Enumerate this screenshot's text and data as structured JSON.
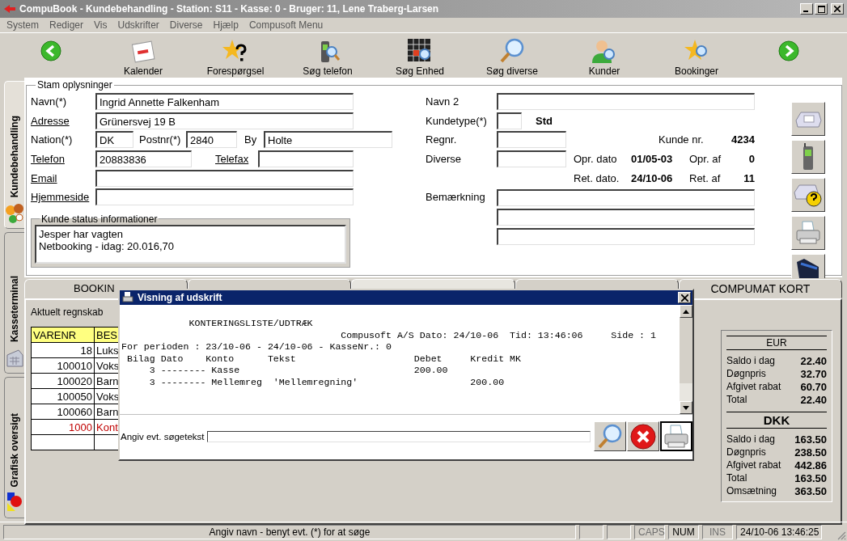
{
  "window": {
    "title": "CompuBook - Kundebehandling - Station: S11 - Kasse: 0 - Bruger: 11, Lene Traberg-Larsen"
  },
  "menu": [
    "System",
    "Rediger",
    "Vis",
    "Udskrifter",
    "Diverse",
    "Hjælp",
    "Compusoft Menu"
  ],
  "toolbar": [
    {
      "kind": "back"
    },
    {
      "kind": "calendar",
      "label": "Kalender"
    },
    {
      "kind": "question",
      "label": "Forespørgsel"
    },
    {
      "kind": "mobile",
      "label": "Søg telefon"
    },
    {
      "kind": "grid",
      "label": "Søg Enhed"
    },
    {
      "kind": "magnifier",
      "label": "Søg diverse"
    },
    {
      "kind": "person",
      "label": "Kunder"
    },
    {
      "kind": "star",
      "label": "Bookinger"
    },
    {
      "kind": "forward"
    }
  ],
  "side_tabs": [
    {
      "label": "Kundebehandling",
      "selected": true,
      "kind": "people"
    },
    {
      "label": "Kasseterminal",
      "selected": false,
      "kind": "register"
    },
    {
      "label": "Grafisk oversigt",
      "selected": false,
      "kind": "shapes"
    }
  ],
  "master": {
    "legend": "Stam oplysninger",
    "fields": {
      "navn": {
        "label": "Navn(*)",
        "underlined": false,
        "value": "Ingrid Annette Falkenham"
      },
      "adresse": {
        "label": "Adresse",
        "underlined": true,
        "value": "Grünersvej 19 B"
      },
      "nation": {
        "label": "Nation(*)",
        "underlined": false,
        "value": "DK"
      },
      "postnr": {
        "label": "Postnr(*)",
        "underlined": false,
        "value": "2840"
      },
      "by": {
        "label": "By",
        "underlined": false,
        "value": "Holte"
      },
      "telefon": {
        "label": "Telefon",
        "underlined": true,
        "value": "20883836"
      },
      "telefax": {
        "label": "Telefax",
        "underlined": true
      },
      "email": {
        "label": "Email",
        "underlined": true
      },
      "hjemmeside": {
        "label": "Hjemmeside",
        "underlined": true
      },
      "navn2": {
        "label": "Navn 2"
      },
      "kundetype": {
        "label": "Kundetype(*)",
        "text": "Std"
      },
      "regnr": {
        "label": "Regnr."
      },
      "diverse": {
        "label": "Diverse"
      },
      "bemaerkning": {
        "label": "Bemærkning"
      }
    },
    "info": {
      "kunde_nr": {
        "label": "Kunde nr.",
        "value": "4234"
      },
      "opr_dato": {
        "label": "Opr. dato",
        "value": "01/05-03"
      },
      "opr_af": {
        "label": "Opr. af",
        "value": "0"
      },
      "ret_dato": {
        "label": "Ret. dato.",
        "value": "24/10-06"
      },
      "ret_af": {
        "label": "Ret. af",
        "value": "11"
      }
    }
  },
  "side_buttons": [
    {
      "kind": "phone"
    },
    {
      "kind": "mobile"
    },
    {
      "kind": "phone-help"
    },
    {
      "kind": "printer"
    },
    {
      "kind": "folder"
    }
  ],
  "status_info": {
    "legend": "Kunde status informationer",
    "lines": [
      "Jesper har vagten",
      "Netbooking - idag: 20.016,70"
    ]
  },
  "tabs": [
    {
      "label": "BOOKIN",
      "selected": false
    },
    {
      "selected": false
    },
    {
      "selected": true
    },
    {
      "selected": false
    },
    {
      "label": "COMPUMAT KORT",
      "selected": false
    }
  ],
  "regnskab": {
    "caption": "Aktuelt regnskab",
    "columns": [
      "VARENR",
      "BES"
    ],
    "rows": [
      {
        "cells": [
          "18",
          "Luks"
        ],
        "flagged": false
      },
      {
        "cells": [
          "100010",
          "Voks"
        ],
        "flagged": false
      },
      {
        "cells": [
          "100020",
          "Barn"
        ],
        "flagged": false
      },
      {
        "cells": [
          "100050",
          "Voks"
        ],
        "flagged": false
      },
      {
        "cells": [
          "100060",
          "Barn"
        ],
        "flagged": false
      },
      {
        "cells": [
          "1000",
          "Kont"
        ],
        "flagged": true
      }
    ]
  },
  "summary": [
    {
      "currency": "EUR",
      "rows": [
        {
          "label": "Saldo i dag",
          "value": "22.40"
        },
        {
          "label": "Døgnpris",
          "value": "32.70"
        },
        {
          "label": "Afgivet rabat",
          "value": "60.70"
        },
        {
          "label": "Total",
          "value": "22.40"
        }
      ]
    },
    {
      "currency": "DKK",
      "rows": [
        {
          "label": "Saldo i dag",
          "value": "163.50"
        },
        {
          "label": "Døgnpris",
          "value": "238.50"
        },
        {
          "label": "Afgivet rabat",
          "value": "442.86"
        },
        {
          "label": "Total",
          "value": "163.50"
        },
        {
          "label": "Omsætning",
          "value": "363.50"
        }
      ]
    }
  ],
  "dialog": {
    "title": "Visning af udskrift",
    "report": [
      "            KONTERINGSLISTE/UDTRÆK",
      "                                       Compusoft A/S Dato: 24/10-06  Tid: 13:46:06     Side : 1",
      "For perioden : 23/10-06 - 24/10-06 - KasseNr.: 0",
      " Bilag Dato    Konto      Tekst                     Debet     Kredit MK",
      "     3 -------- Kasse                               200.00",
      "     3 -------- Mellemreg  'Mellemregning'                    200.00"
    ],
    "search_label": "Angiv evt. søgetekst"
  },
  "status_bar": {
    "message": "Angiv navn - benyt evt. (*) for at søge",
    "indicators": [
      {
        "label": "CAPS",
        "on": false
      },
      {
        "label": "NUM",
        "on": true
      },
      {
        "label": "INS",
        "on": false
      }
    ],
    "datetime": "24/10-06 13:46:25"
  }
}
